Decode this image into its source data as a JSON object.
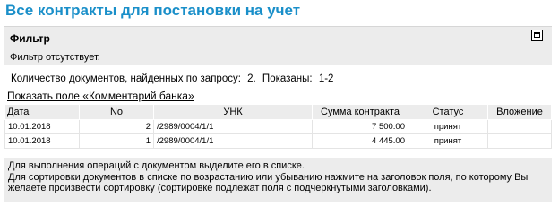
{
  "page": {
    "title": "Все контракты для постановки на учет"
  },
  "filter": {
    "title": "Фильтр",
    "toggle_icon": "maximize-icon",
    "status_text": "Фильтр отсутствует."
  },
  "counts": {
    "found_label": "Количество  документов, найденных по запросу:",
    "found_value": "2.",
    "shown_label": "Показаны:",
    "shown_value": "1-2"
  },
  "links": {
    "show_bank_comment": "Показать поле «Комментарий банка»"
  },
  "table": {
    "headers": {
      "date": "Дата",
      "number": "No",
      "unk": "УНК",
      "sum": "Сумма контракта",
      "status": "Статус",
      "attachment": "Вложение"
    },
    "rows": [
      {
        "date": "10.01.2018",
        "number": "2",
        "unk": "/2989/0004/1/1",
        "sum": "7 500.00",
        "status": "принят",
        "attachment": ""
      },
      {
        "date": "10.01.2018",
        "number": "1",
        "unk": "/2989/0004/1/1",
        "sum": "4 445.00",
        "status": "принят",
        "attachment": ""
      }
    ]
  },
  "help": {
    "line1": "Для выполнения операций с документом выделите его в списке.",
    "line2": "Для сортировки документов в списке по возрастанию или убыванию нажмите на заголовок поля, по которому Вы желаете произвести сортировку (сортировке подлежат поля с подчеркнутыми заголовками)."
  }
}
